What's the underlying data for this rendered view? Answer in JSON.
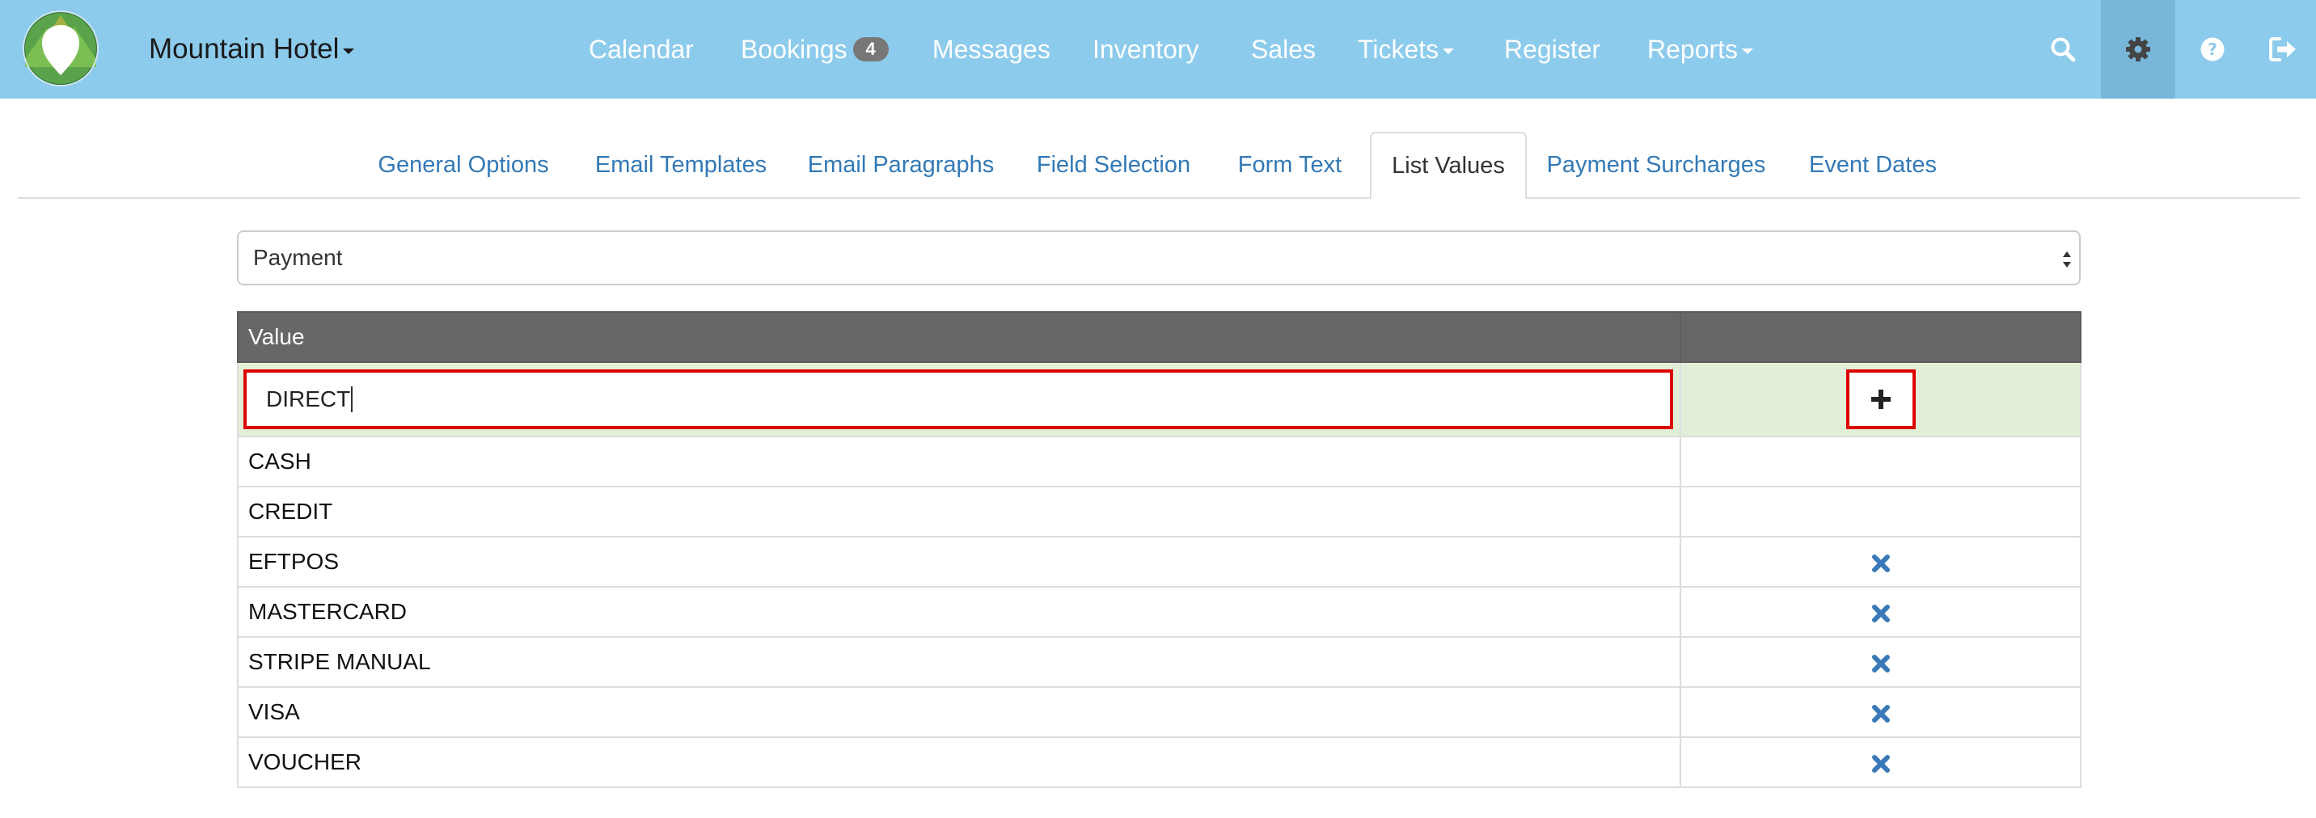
{
  "app": {
    "brand": "Mountain Hotel",
    "logo_icon": "mountain-hotel-logo"
  },
  "nav": {
    "items": [
      {
        "label": "Calendar"
      },
      {
        "label": "Bookings",
        "badge": "4"
      },
      {
        "label": "Messages"
      },
      {
        "label": "Inventory"
      },
      {
        "label": "Sales"
      },
      {
        "label": "Tickets",
        "dropdown": true
      },
      {
        "label": "Register"
      },
      {
        "label": "Reports",
        "dropdown": true
      }
    ],
    "icons": [
      "search-icon",
      "gear-icon",
      "help-icon",
      "logout-icon"
    ]
  },
  "tabs": [
    {
      "label": "General Options"
    },
    {
      "label": "Email Templates"
    },
    {
      "label": "Email Paragraphs"
    },
    {
      "label": "Field Selection"
    },
    {
      "label": "Form Text"
    },
    {
      "label": "List Values",
      "active": true
    },
    {
      "label": "Payment Surcharges"
    },
    {
      "label": "Event Dates"
    }
  ],
  "list_select": {
    "selected": "Payment"
  },
  "table": {
    "header_value": "Value",
    "new_value_input": "DIRECT",
    "rows": [
      {
        "value": "CASH",
        "removable": false
      },
      {
        "value": "CREDIT",
        "removable": false
      },
      {
        "value": "EFTPOS",
        "removable": true
      },
      {
        "value": "MASTERCARD",
        "removable": true
      },
      {
        "value": "STRIPE MANUAL",
        "removable": true
      },
      {
        "value": "VISA",
        "removable": true
      },
      {
        "value": "VOUCHER",
        "removable": true
      }
    ]
  },
  "colors": {
    "navbar": "#8ccbec",
    "link": "#3379b5",
    "table_header": "#676767",
    "add_row_bg": "#e2efd8",
    "highlight": "#dd0000"
  }
}
